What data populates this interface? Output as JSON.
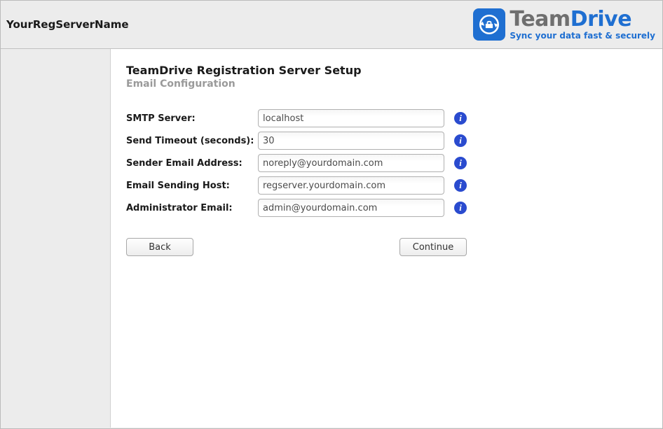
{
  "header": {
    "reg_server_name": "YourRegServerName",
    "brand_team": "Team",
    "brand_drive": "Drive",
    "tagline": "Sync your data fast & securely"
  },
  "page": {
    "title": "TeamDrive Registration Server Setup",
    "subtitle": "Email Configuration"
  },
  "form": {
    "smtp_server": {
      "label": "SMTP Server:",
      "value": "localhost"
    },
    "send_timeout": {
      "label": "Send Timeout (seconds):",
      "value": "30"
    },
    "sender_email": {
      "label": "Sender Email Address:",
      "value": "noreply@yourdomain.com"
    },
    "sending_host": {
      "label": "Email Sending Host:",
      "value": "regserver.yourdomain.com"
    },
    "admin_email": {
      "label": "Administrator Email:",
      "value": "admin@yourdomain.com"
    }
  },
  "buttons": {
    "back": "Back",
    "continue": "Continue"
  }
}
